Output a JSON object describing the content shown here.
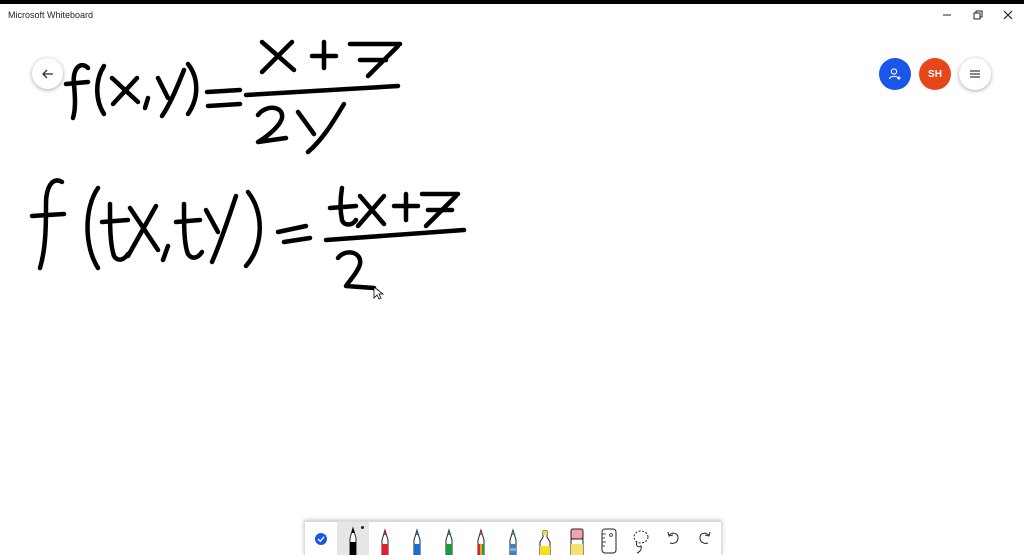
{
  "window": {
    "title": "Microsoft Whiteboard",
    "minimize_icon": "minimize-icon",
    "maximize_icon": "restore-icon",
    "close_icon": "close-icon"
  },
  "header": {
    "back_icon": "arrow-left-icon",
    "invite_icon": "add-person-icon",
    "avatar_initials": "SH",
    "menu_icon": "hamburger-menu-icon"
  },
  "colors": {
    "invite_bg": "#1a56e8",
    "avatar_bg": "#e5461a",
    "ink": "#000000"
  },
  "ink_content": {
    "line1": "f(x,y) = (x+7)/(2y)",
    "line2": "f(tx,ty) = (tx+7)/2"
  },
  "toolbar": {
    "tools": [
      {
        "name": "ink-to-shape-toggle",
        "icon": "checkmark-icon"
      },
      {
        "name": "pen-black",
        "icon": "pen-icon",
        "color": "#000000",
        "selected": true
      },
      {
        "name": "pen-red",
        "icon": "pen-icon",
        "color": "#e02030"
      },
      {
        "name": "pen-blue",
        "icon": "pen-icon",
        "color": "#1a70d0"
      },
      {
        "name": "pen-green",
        "icon": "pen-icon",
        "color": "#1a9a40"
      },
      {
        "name": "pen-rainbow",
        "icon": "pen-icon",
        "color": "#d04080"
      },
      {
        "name": "pen-galaxy",
        "icon": "pen-icon",
        "color": "#4090c0"
      },
      {
        "name": "highlighter-yellow",
        "icon": "highlighter-icon",
        "color": "#f5e020"
      },
      {
        "name": "eraser",
        "icon": "eraser-icon",
        "color": "#f4a0b0"
      },
      {
        "name": "ruler",
        "icon": "ruler-icon"
      },
      {
        "name": "lasso-select",
        "icon": "lasso-icon"
      },
      {
        "name": "undo",
        "icon": "undo-icon"
      },
      {
        "name": "redo",
        "icon": "redo-icon"
      }
    ]
  }
}
